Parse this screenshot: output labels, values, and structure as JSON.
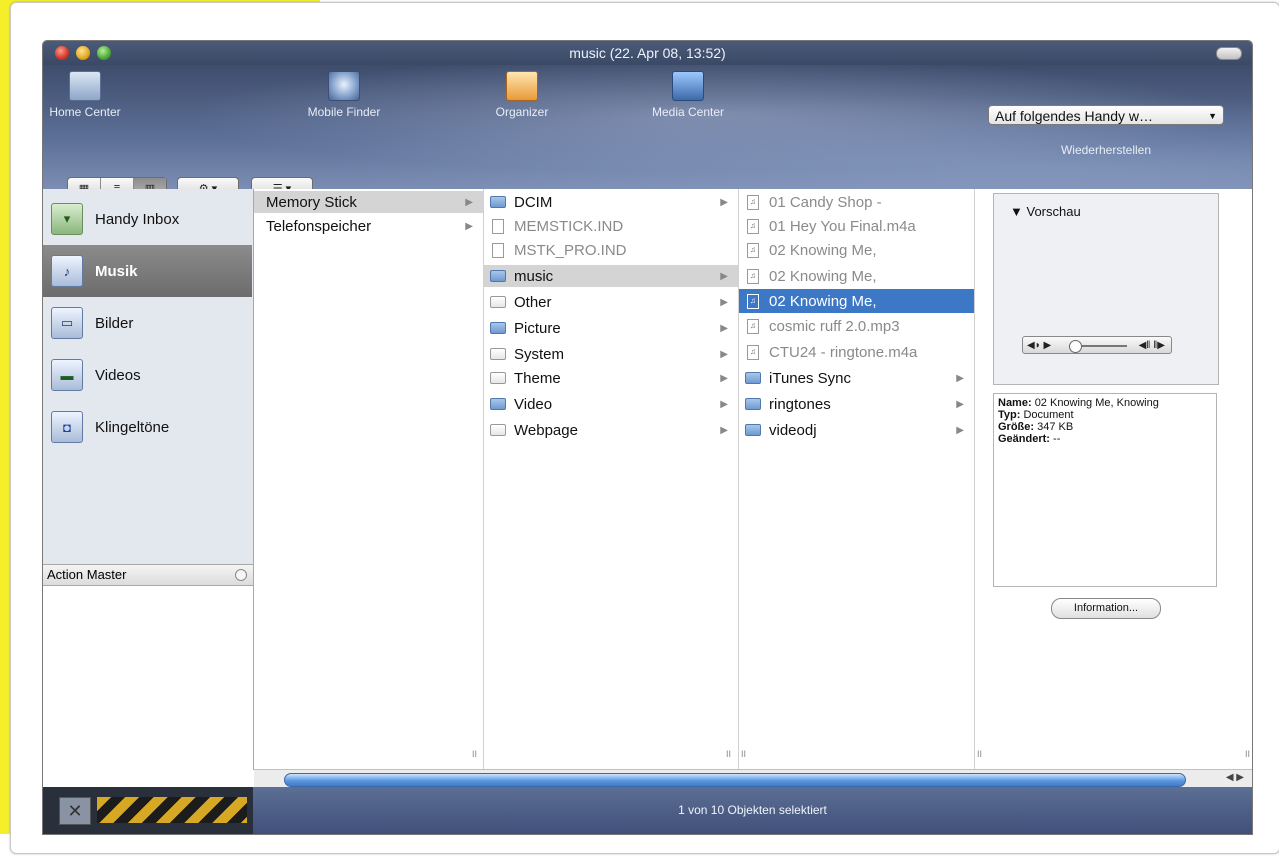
{
  "window": {
    "title": "music (22. Apr 08, 13:52)"
  },
  "toolbar": {
    "items": [
      {
        "label": "Home Center",
        "icon": "home-icon"
      },
      {
        "label": "Mobile Finder",
        "icon": "finder-icon"
      },
      {
        "label": "Organizer",
        "icon": "organizer-icon"
      },
      {
        "label": "Media Center",
        "icon": "media-center-icon"
      }
    ],
    "handy_select": "Auf folgendes Handy w…",
    "restore_label": "Wiederherstellen"
  },
  "sidebar": {
    "items": [
      {
        "label": "Handy Inbox",
        "icon": "inbox-icon"
      },
      {
        "label": "Musik",
        "icon": "music-icon",
        "selected": true
      },
      {
        "label": "Bilder",
        "icon": "pictures-icon"
      },
      {
        "label": "Videos",
        "icon": "videos-icon"
      },
      {
        "label": "Klingeltöne",
        "icon": "ringtones-icon"
      }
    ]
  },
  "action_master": {
    "title": "Action Master"
  },
  "columns": {
    "col1": [
      {
        "label": "Memory Stick"
      },
      {
        "label": "Telefonspeicher"
      }
    ],
    "col2": [
      {
        "label": "DCIM"
      },
      {
        "label": "MEMSTICK.IND"
      },
      {
        "label": "MSTK_PRO.IND"
      },
      {
        "label": "music"
      },
      {
        "label": "Other"
      },
      {
        "label": "Picture"
      },
      {
        "label": "System"
      },
      {
        "label": "Theme"
      },
      {
        "label": "Video"
      },
      {
        "label": "Webpage"
      }
    ],
    "col3": [
      {
        "label": "01 Candy Shop -"
      },
      {
        "label": "01 Hey You Final.m4a"
      },
      {
        "label": "02 Knowing Me,"
      },
      {
        "label": "02 Knowing Me,"
      },
      {
        "label": "02 Knowing Me,"
      },
      {
        "label": "cosmic ruff 2.0.mp3"
      },
      {
        "label": "CTU24 - ringtone.m4a"
      },
      {
        "label": "iTunes Sync"
      },
      {
        "label": "ringtones"
      },
      {
        "label": "videodj"
      }
    ]
  },
  "preview": {
    "title": "Vorschau"
  },
  "info": {
    "name_label": "Name:",
    "name_value": "02 Knowing Me, Knowing",
    "type_label": "Typ:",
    "type_value": "Document",
    "size_label": "Größe:",
    "size_value": "347 KB",
    "changed_label": "Geändert:",
    "changed_value": "--",
    "button": "Information..."
  },
  "status": {
    "text": "1 von 10 Objekten selektiert"
  },
  "colors": {
    "accent": "#3d78c6",
    "sidebar_selected": "#7a7a7a",
    "hazard": "#d6a823"
  }
}
